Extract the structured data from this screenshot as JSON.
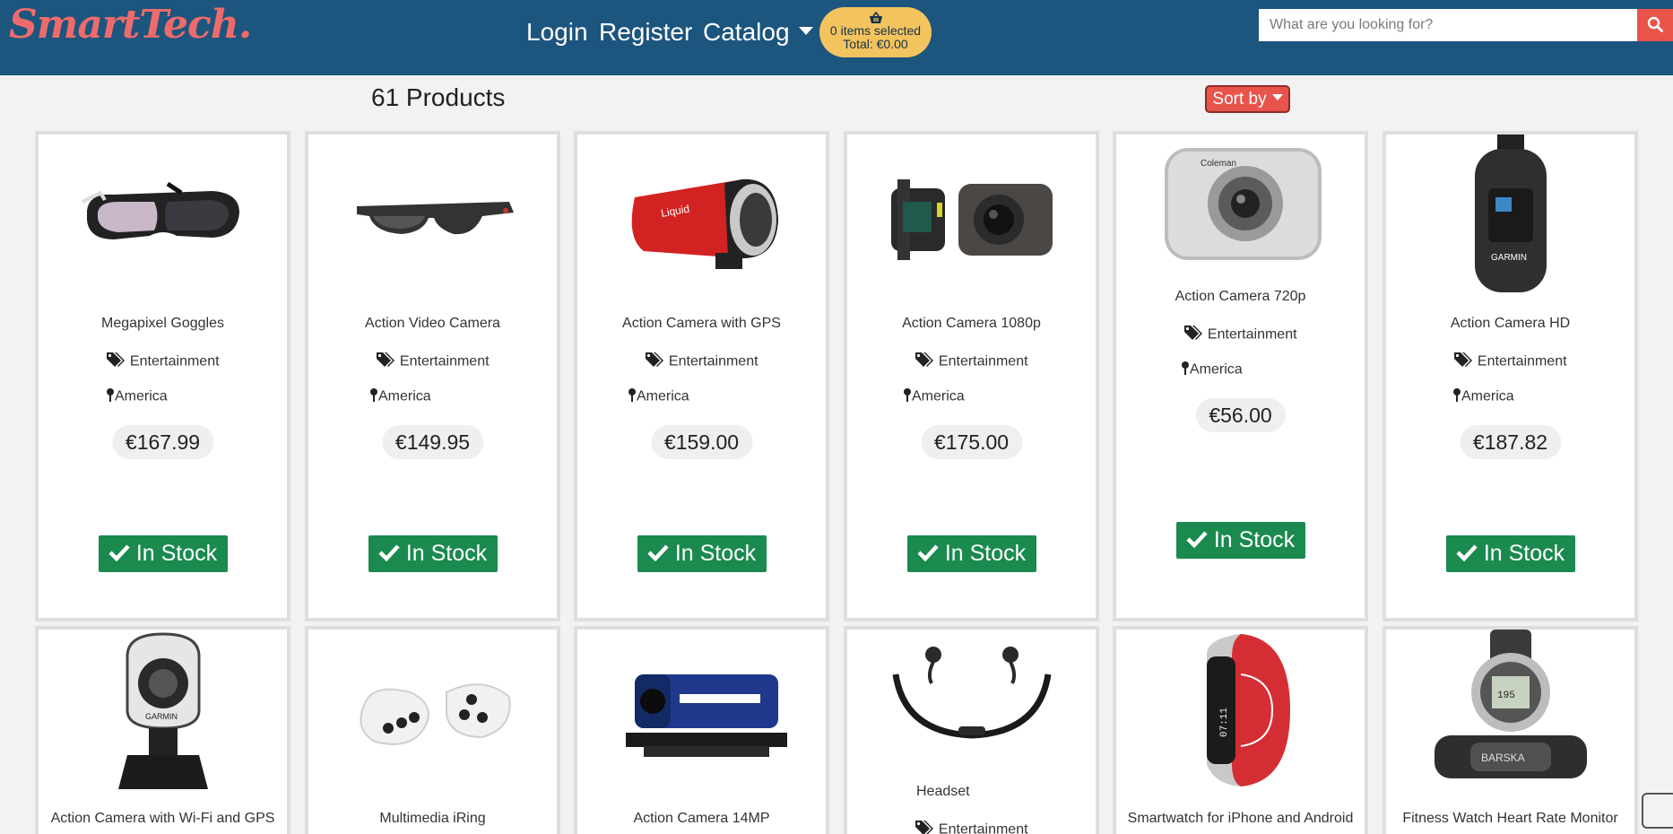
{
  "brand": "SmartTech.",
  "nav": {
    "login": "Login",
    "register": "Register",
    "catalog": "Catalog"
  },
  "cart": {
    "items_text": "0 items selected",
    "total_text": "Total: €0.00"
  },
  "search": {
    "placeholder": "What are you looking for?",
    "value": ""
  },
  "products_count": "61 Products",
  "sort_label": "Sort by",
  "products": [
    {
      "name": "Megapixel Goggles",
      "category": "Entertainment",
      "location": "America",
      "price": "€167.99",
      "stock": "In Stock",
      "image": "goggles-image"
    },
    {
      "name": "Action Video Camera",
      "category": "Entertainment",
      "location": "America",
      "price": "€149.95",
      "stock": "In Stock",
      "image": "camera-glasses-image"
    },
    {
      "name": "Action Camera with GPS",
      "category": "Entertainment",
      "location": "America",
      "price": "€159.00",
      "stock": "In Stock",
      "image": "red-action-camera-image"
    },
    {
      "name": "Action Camera 1080p",
      "category": "Entertainment",
      "location": "America",
      "price": "€175.00",
      "stock": "In Stock",
      "image": "action-camera-remote-image"
    },
    {
      "name": "Action Camera 720p",
      "category": "Entertainment",
      "location": "America",
      "price": "€56.00",
      "stock": "In Stock",
      "image": "silver-camera-image"
    },
    {
      "name": "Action Camera HD",
      "category": "Entertainment",
      "location": "America",
      "price": "€187.82",
      "stock": "In Stock",
      "image": "garmin-camera-image"
    },
    {
      "name": "Action Camera with Wi-Fi and GPS",
      "image": "garmin-virb-image"
    },
    {
      "name": "Multimedia iRing",
      "image": "iring-image"
    },
    {
      "name": "Action Camera 14MP",
      "image": "blue-action-camera-image"
    },
    {
      "name": "Headset",
      "category": "Entertainment",
      "image": "headset-image"
    },
    {
      "name": "Smartwatch for iPhone and Android",
      "image": "smartwatch-image"
    },
    {
      "name": "Fitness Watch Heart Rate Monitor",
      "image": "fitness-watch-image"
    }
  ]
}
